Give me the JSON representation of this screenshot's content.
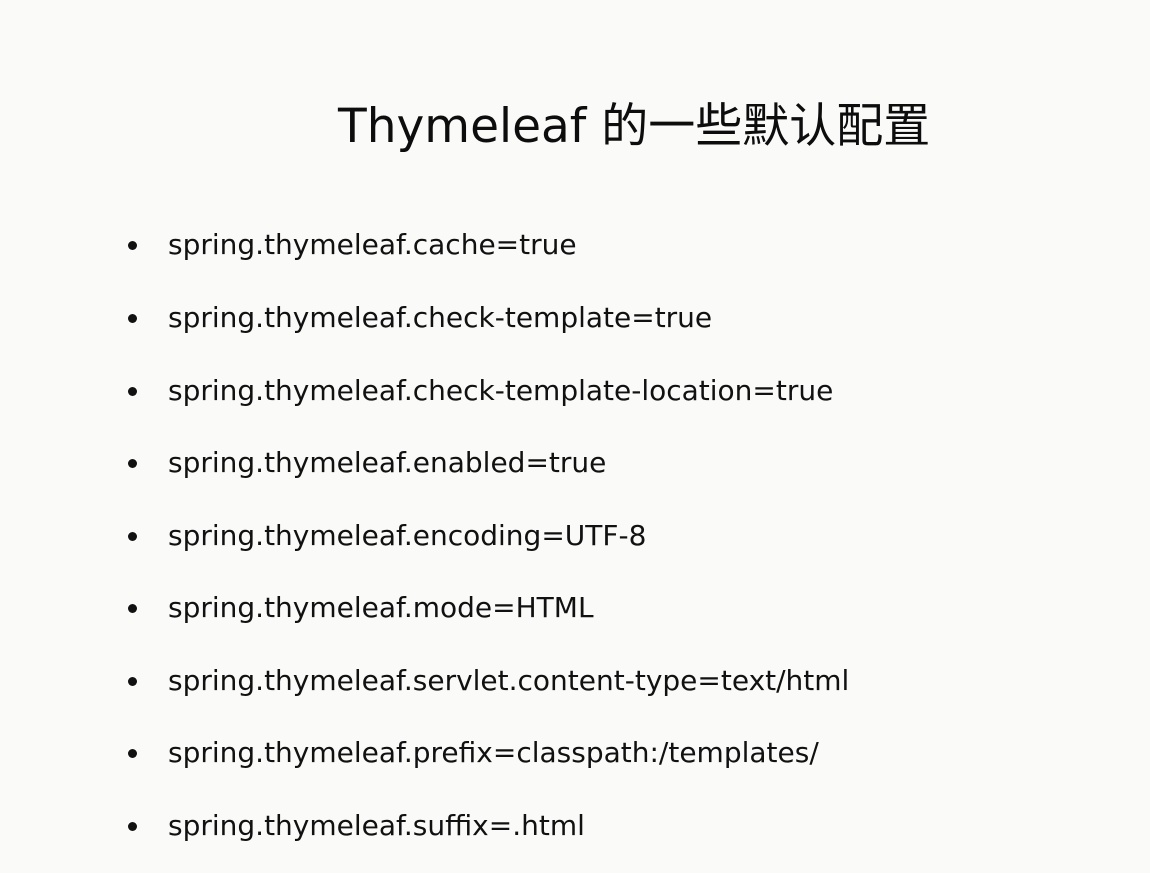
{
  "slide": {
    "title": "Thymeleaf 的一些默认配置",
    "items": [
      "spring.thymeleaf.cache=true",
      "spring.thymeleaf.check-template=true",
      "spring.thymeleaf.check-template-location=true",
      "spring.thymeleaf.enabled=true",
      "spring.thymeleaf.encoding=UTF-8",
      "spring.thymeleaf.mode=HTML",
      "spring.thymeleaf.servlet.content-type=text/html",
      "spring.thymeleaf.prefix=classpath:/templates/",
      "spring.thymeleaf.suffix=.html"
    ]
  }
}
